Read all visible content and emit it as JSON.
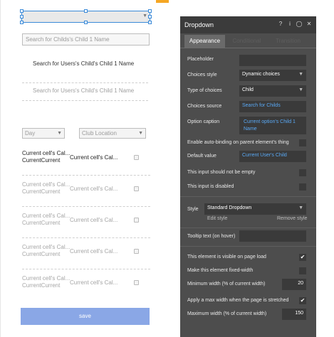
{
  "canvas": {
    "search_placeholder_1": "Search for Childs's Child 1 Name",
    "search_text_static": "Search for Users's Child's Child 1 Name",
    "search_placeholder_2": "Search for Users's Child's Child 1 Name",
    "day_dropdown": "Day",
    "club_dropdown": "Club Location",
    "rows": [
      {
        "col1_line1": "Current cell's Cal...",
        "col1_line2": "CurrentCurrent",
        "col2": "Current cell's Cal..."
      },
      {
        "col1_line1": "Current cell's Cal...",
        "col1_line2": "CurrentCurrent",
        "col2": "Current cell's Cal..."
      },
      {
        "col1_line1": "Current cell's Cal...",
        "col1_line2": "CurrentCurrent",
        "col2": "Current cell's Cal..."
      },
      {
        "col1_line1": "Current cell's Cal...",
        "col1_line2": "CurrentCurrent",
        "col2": "Current cell's Cal..."
      },
      {
        "col1_line1": "Current cell's Cal...",
        "col1_line2": "CurrentCurrent",
        "col2": "Current cell's Cal..."
      }
    ],
    "save_label": "save"
  },
  "panel": {
    "title": "Dropdown",
    "icons": [
      "help-icon",
      "info-icon",
      "comment-icon",
      "close-icon"
    ],
    "icon_glyphs": [
      "?",
      "i",
      "◯",
      "✕"
    ],
    "tabs": [
      "Appearance",
      "Conditional",
      "Transition"
    ],
    "placeholder_label": "Placeholder",
    "choices_style_label": "Choices style",
    "choices_style_value": "Dynamic choices",
    "type_label": "Type of choices",
    "type_value": "Child",
    "source_label": "Choices source",
    "source_value": "Search for Childs",
    "caption_label": "Option caption",
    "caption_value_line1": "Current option's Child 1",
    "caption_value_line2": "Name",
    "autobind_label": "Enable auto-binding on parent element's thing",
    "default_label": "Default value",
    "default_value": "Current User's Child",
    "not_empty_label": "This input should not be empty",
    "disabled_label": "This input is disabled",
    "style_label": "Style",
    "style_value": "Standard Dropdown",
    "edit_style": "Edit style",
    "remove_style": "Remove style",
    "tooltip_label": "Tooltip text (on hover)",
    "visible_label": "This element is visible on page load",
    "fixed_width_label": "Make this element fixed-width",
    "min_width_label": "Minimum width (% of current width)",
    "min_width_value": "20",
    "max_width_apply_label": "Apply a max width when the page is stretched",
    "max_width_label": "Maximum width (% of current width)",
    "max_width_value": "150",
    "check_glyph": "✔"
  },
  "colors": {
    "selection": "#3b8ad8",
    "save_button": "#8aa7e6",
    "panel_bg": "#4d4d4d",
    "panel_link": "#5aa9f5",
    "accent_tick": "#f5a623"
  }
}
